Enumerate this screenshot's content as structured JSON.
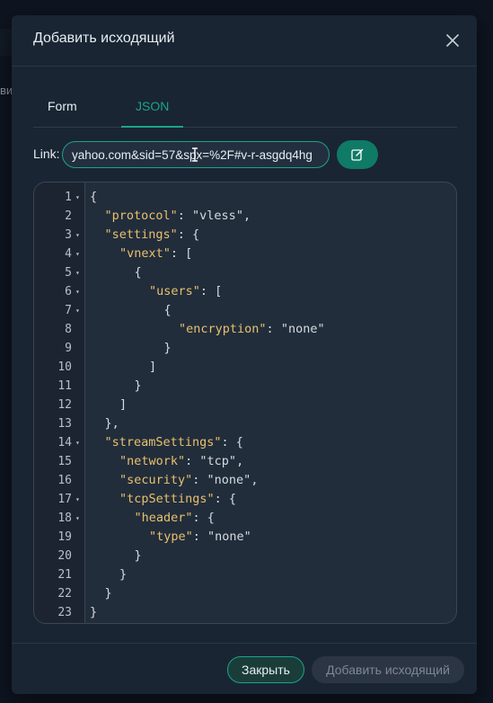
{
  "background": {
    "clipped_text": "ви"
  },
  "modal": {
    "title": "Добавить исходящий",
    "tabs": [
      {
        "label": "Form",
        "active": false
      },
      {
        "label": "JSON",
        "active": true
      }
    ],
    "link": {
      "label": "Link:",
      "value": "yahoo.com&sid=57&spx=%2F#v-r-asgdq4hg"
    },
    "editor": {
      "lines": [
        {
          "n": "1",
          "fold": true,
          "indent": 0,
          "parts": [
            [
              "p",
              "{"
            ]
          ]
        },
        {
          "n": "2",
          "fold": false,
          "indent": 1,
          "parts": [
            [
              "k",
              "\"protocol\""
            ],
            [
              "p",
              ": "
            ],
            [
              "s",
              "\"vless\""
            ],
            [
              "p",
              ","
            ]
          ]
        },
        {
          "n": "3",
          "fold": true,
          "indent": 1,
          "parts": [
            [
              "k",
              "\"settings\""
            ],
            [
              "p",
              ": {"
            ]
          ]
        },
        {
          "n": "4",
          "fold": true,
          "indent": 2,
          "parts": [
            [
              "k",
              "\"vnext\""
            ],
            [
              "p",
              ": ["
            ]
          ]
        },
        {
          "n": "5",
          "fold": true,
          "indent": 3,
          "parts": [
            [
              "p",
              "{"
            ]
          ]
        },
        {
          "n": "6",
          "fold": true,
          "indent": 4,
          "parts": [
            [
              "k",
              "\"users\""
            ],
            [
              "p",
              ": ["
            ]
          ]
        },
        {
          "n": "7",
          "fold": true,
          "indent": 5,
          "parts": [
            [
              "p",
              "{"
            ]
          ]
        },
        {
          "n": "8",
          "fold": false,
          "indent": 6,
          "parts": [
            [
              "k",
              "\"encryption\""
            ],
            [
              "p",
              ": "
            ],
            [
              "s",
              "\"none\""
            ]
          ]
        },
        {
          "n": "9",
          "fold": false,
          "indent": 5,
          "parts": [
            [
              "p",
              "}"
            ]
          ]
        },
        {
          "n": "10",
          "fold": false,
          "indent": 4,
          "parts": [
            [
              "p",
              "]"
            ]
          ]
        },
        {
          "n": "11",
          "fold": false,
          "indent": 3,
          "parts": [
            [
              "p",
              "}"
            ]
          ]
        },
        {
          "n": "12",
          "fold": false,
          "indent": 2,
          "parts": [
            [
              "p",
              "]"
            ]
          ]
        },
        {
          "n": "13",
          "fold": false,
          "indent": 1,
          "parts": [
            [
              "p",
              "},"
            ]
          ]
        },
        {
          "n": "14",
          "fold": true,
          "indent": 1,
          "parts": [
            [
              "k",
              "\"streamSettings\""
            ],
            [
              "p",
              ": {"
            ]
          ]
        },
        {
          "n": "15",
          "fold": false,
          "indent": 2,
          "parts": [
            [
              "k",
              "\"network\""
            ],
            [
              "p",
              ": "
            ],
            [
              "s",
              "\"tcp\""
            ],
            [
              "p",
              ","
            ]
          ]
        },
        {
          "n": "16",
          "fold": false,
          "indent": 2,
          "parts": [
            [
              "k",
              "\"security\""
            ],
            [
              "p",
              ": "
            ],
            [
              "s",
              "\"none\""
            ],
            [
              "p",
              ","
            ]
          ]
        },
        {
          "n": "17",
          "fold": true,
          "indent": 2,
          "parts": [
            [
              "k",
              "\"tcpSettings\""
            ],
            [
              "p",
              ": {"
            ]
          ]
        },
        {
          "n": "18",
          "fold": true,
          "indent": 3,
          "parts": [
            [
              "k",
              "\"header\""
            ],
            [
              "p",
              ": {"
            ]
          ]
        },
        {
          "n": "19",
          "fold": false,
          "indent": 4,
          "parts": [
            [
              "k",
              "\"type\""
            ],
            [
              "p",
              ": "
            ],
            [
              "s",
              "\"none\""
            ]
          ]
        },
        {
          "n": "20",
          "fold": false,
          "indent": 3,
          "parts": [
            [
              "p",
              "}"
            ]
          ]
        },
        {
          "n": "21",
          "fold": false,
          "indent": 2,
          "parts": [
            [
              "p",
              "}"
            ]
          ]
        },
        {
          "n": "22",
          "fold": false,
          "indent": 1,
          "parts": [
            [
              "p",
              "}"
            ]
          ]
        },
        {
          "n": "23",
          "fold": false,
          "indent": 0,
          "parts": [
            [
              "p",
              "}"
            ]
          ]
        }
      ]
    },
    "footer": {
      "close_label": "Закрыть",
      "add_label": "Добавить исходящий"
    }
  },
  "icons": {
    "close": "close-icon",
    "edit": "edit-icon",
    "fold": "fold-arrow-icon",
    "cursor": "text-cursor-icon"
  },
  "colors": {
    "accent": "#1aa38a",
    "modal_bg": "#1a2533",
    "json_key": "#e7c06f"
  }
}
